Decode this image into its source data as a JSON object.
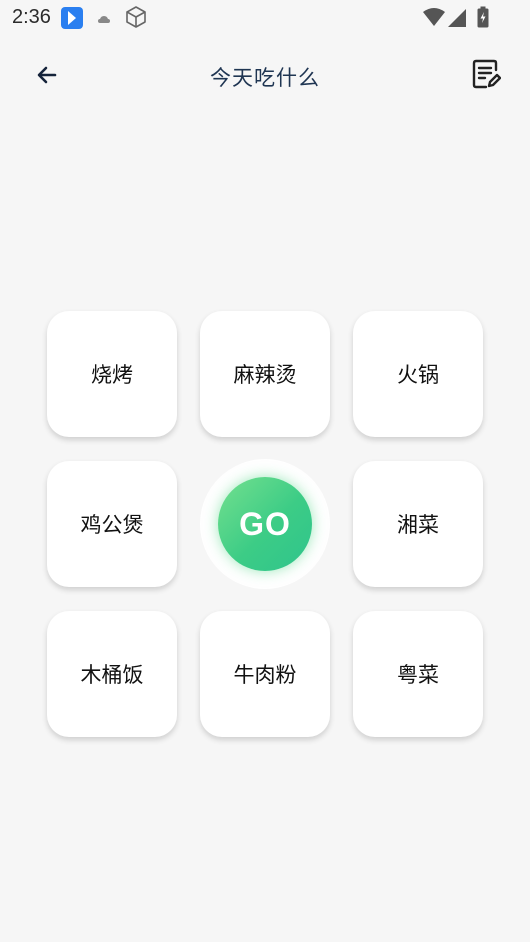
{
  "status_bar": {
    "time": "2:36",
    "icons": [
      "app-badge-icon",
      "cloud-icon",
      "cube-icon",
      "wifi-icon",
      "signal-icon",
      "battery-icon"
    ]
  },
  "header": {
    "title": "今天吃什么",
    "back_icon": "arrow-left-icon",
    "edit_icon": "edit-note-icon"
  },
  "foods": [
    {
      "label": "烧烤"
    },
    {
      "label": "麻辣烫"
    },
    {
      "label": "火锅"
    },
    {
      "label": "鸡公煲"
    },
    {
      "label": "湘菜"
    },
    {
      "label": "木桶饭"
    },
    {
      "label": "牛肉粉"
    },
    {
      "label": "粤菜"
    }
  ],
  "go_button": {
    "label": "GO"
  },
  "colors": {
    "background": "#f6f6f6",
    "title": "#1f3552",
    "go_gradient_start": "#74e08e",
    "go_gradient_end": "#2fc48c",
    "card": "#ffffff"
  }
}
